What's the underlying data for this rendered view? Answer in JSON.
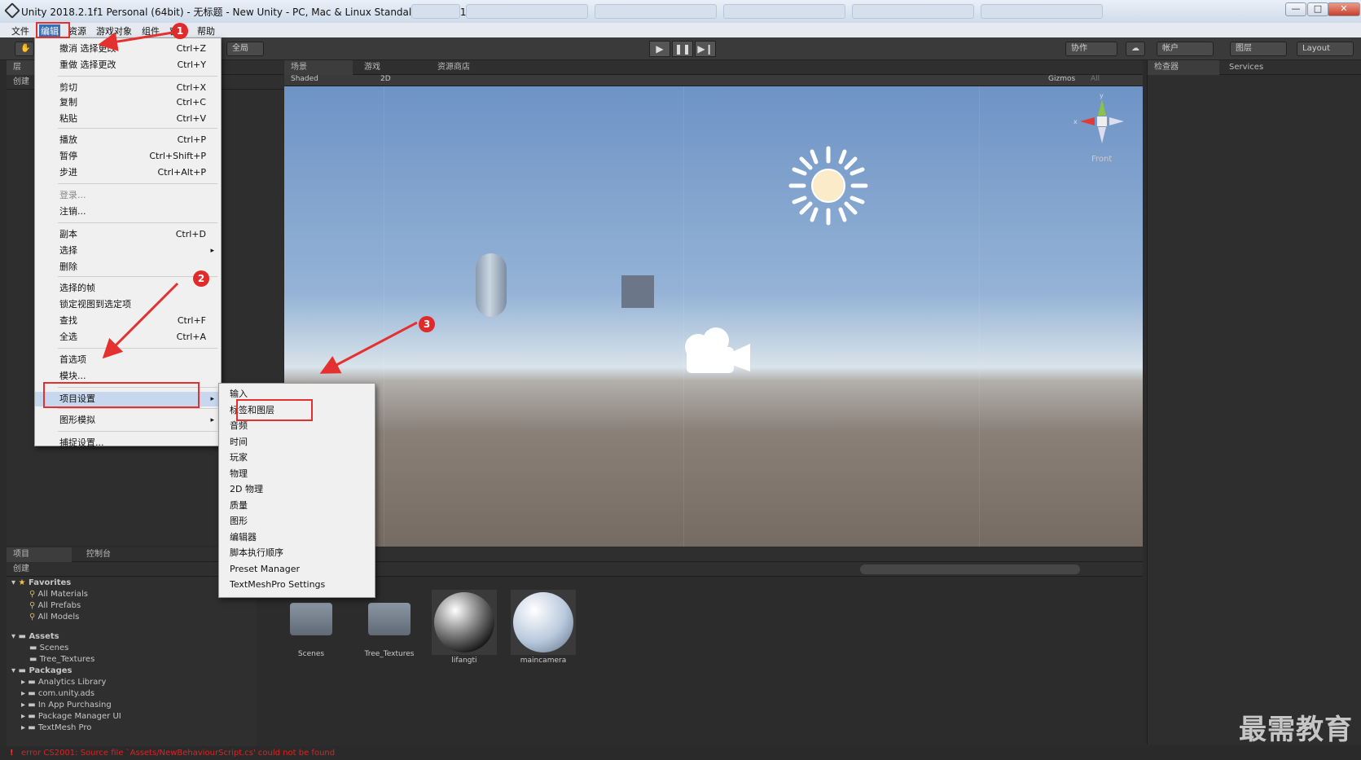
{
  "window": {
    "title": "Unity 2018.2.1f1 Personal (64bit) - 无标题 - New Unity - PC, Mac & Linux Standalone* <DX11>",
    "min": "—",
    "max": "□",
    "close": "✕"
  },
  "menubar": [
    "文件",
    "编辑",
    "资源",
    "游戏对象",
    "组件",
    "窗",
    "帮助"
  ],
  "toolbar": {
    "global": "全局",
    "collab": "协作",
    "account": "帐户",
    "layers": "图层",
    "layout": "Layout"
  },
  "panels": {
    "scene_tab": "场景",
    "game_tab": "游戏",
    "store_tab": "资源商店",
    "shaded": "Shaded",
    "mode2d": "2D",
    "gizmos": "Gizmos",
    "search_all": "All",
    "inspector_tab": "检查器",
    "services_tab": "Services",
    "project_tab": "项目",
    "console_tab": "控制台",
    "create": "创建",
    "hier_tab": "层",
    "front": "Front",
    "gizmo_y": "y",
    "gizmo_x": "x"
  },
  "edit_menu": [
    {
      "label": "撤消 选择更改",
      "sc": "Ctrl+Z"
    },
    {
      "label": "重做 选择更改",
      "sc": "Ctrl+Y"
    },
    {
      "label": "剪切",
      "sc": "Ctrl+X"
    },
    {
      "label": "复制",
      "sc": "Ctrl+C"
    },
    {
      "label": "粘贴",
      "sc": "Ctrl+V"
    },
    {
      "label": "播放",
      "sc": "Ctrl+P"
    },
    {
      "label": "暂停",
      "sc": "Ctrl+Shift+P"
    },
    {
      "label": "步进",
      "sc": "Ctrl+Alt+P"
    },
    {
      "label": "登录...",
      "sc": ""
    },
    {
      "label": "注销...",
      "sc": ""
    },
    {
      "label": "副本",
      "sc": "Ctrl+D"
    },
    {
      "label": "选择",
      "sc": "▸"
    },
    {
      "label": "删除",
      "sc": ""
    },
    {
      "label": "选择的帧",
      "sc": ""
    },
    {
      "label": "锁定视图到选定项",
      "sc": ""
    },
    {
      "label": "查找",
      "sc": "Ctrl+F"
    },
    {
      "label": "全选",
      "sc": "Ctrl+A"
    },
    {
      "label": "首选项",
      "sc": ""
    },
    {
      "label": "模块...",
      "sc": ""
    },
    {
      "label": "项目设置",
      "sc": "▸"
    },
    {
      "label": "图形模拟",
      "sc": "▸"
    },
    {
      "label": "捕捉设置...",
      "sc": ""
    }
  ],
  "sub_menu": [
    "输入",
    "标签和图层",
    "音频",
    "时间",
    "玩家",
    "物理",
    "2D 物理",
    "质量",
    "图形",
    "编辑器",
    "脚本执行顺序",
    "Preset Manager",
    "TextMeshPro Settings"
  ],
  "badges": [
    "1",
    "2",
    "3"
  ],
  "project_tree": {
    "favorites": "Favorites",
    "fav_items": [
      "All Materials",
      "All Prefabs",
      "All Models"
    ],
    "assets": "Assets",
    "asset_items": [
      "Scenes",
      "Tree_Textures"
    ],
    "packages": "Packages",
    "package_items": [
      "Analytics Library",
      "com.unity.ads",
      "In App Purchasing",
      "Package Manager UI",
      "TextMesh Pro"
    ]
  },
  "assets_grid": [
    "Scenes",
    "Tree_Textures",
    "lifangti",
    "maincamera"
  ],
  "status": "error CS2001: Source file `Assets/NewBehaviourScript.cs' could not be found",
  "watermark": "最需教育"
}
